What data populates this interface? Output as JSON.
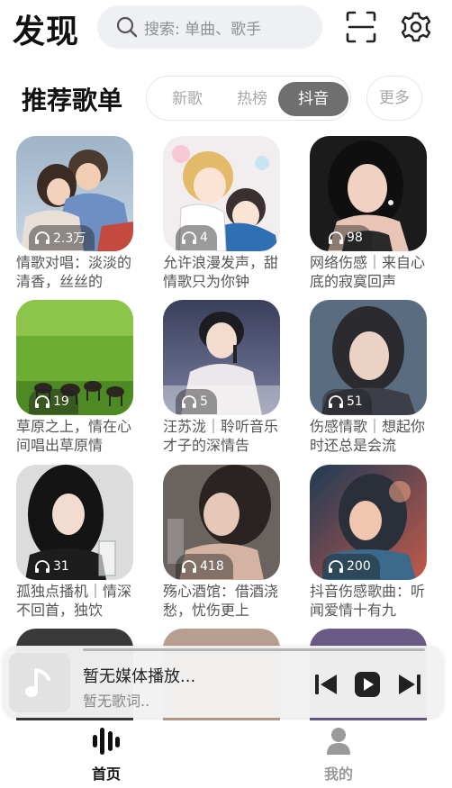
{
  "header": {
    "title": "发现",
    "search_placeholder": "搜索: 单曲、歌手"
  },
  "section": {
    "title": "推荐歌单",
    "tabs": [
      {
        "label": "新歌",
        "active": false
      },
      {
        "label": "热榜",
        "active": false
      },
      {
        "label": "抖音",
        "active": true
      }
    ],
    "more_label": "更多"
  },
  "playlists": [
    {
      "title": "情歌对唱：淡淡的清香，丝丝的",
      "plays": "2.3万"
    },
    {
      "title": "允许浪漫发声，甜情歌只为你钟",
      "plays": "4"
    },
    {
      "title": "网络伤感｜来自心底的寂寞回声",
      "plays": "98"
    },
    {
      "title": "草原之上，情在心间唱出草原情",
      "plays": "19"
    },
    {
      "title": "汪苏泷｜聆听音乐才子的深情告",
      "plays": "5"
    },
    {
      "title": "伤感情歌｜想起你时还总是会流",
      "plays": "51"
    },
    {
      "title": "孤独点播机｜情深不回首，独饮",
      "plays": "31"
    },
    {
      "title": "殇心酒馆：借酒浇愁，忧伤更上",
      "plays": "418"
    },
    {
      "title": "抖音伤感歌曲：听闻爱情十有九",
      "plays": "200"
    }
  ],
  "player": {
    "title": "暂无媒体播放...",
    "subtitle": "暂无歌词.."
  },
  "nav": {
    "home_label": "首页",
    "mine_label": "我的"
  },
  "colors": {
    "active_tab_bg": "#6f6f6f",
    "nav_active": "#111111",
    "nav_inactive": "#9a9a9a"
  }
}
